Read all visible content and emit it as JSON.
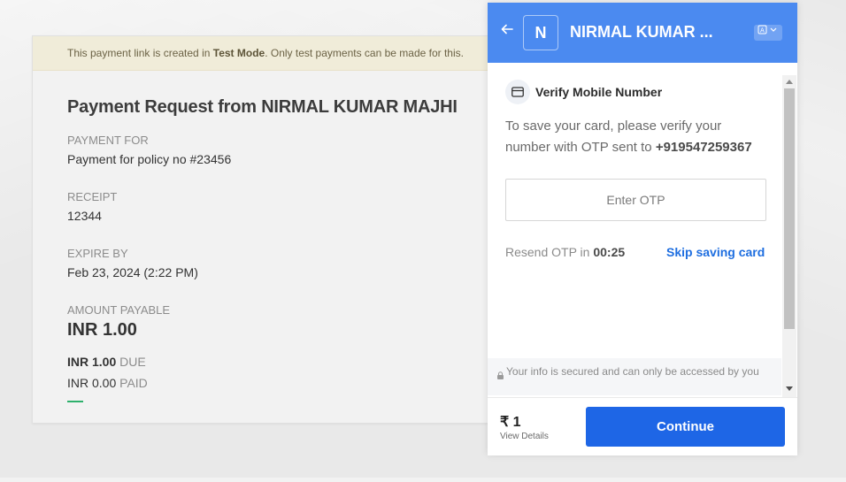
{
  "test_banner": {
    "prefix": "This payment link is created in ",
    "mode": "Test Mode",
    "suffix": ". Only test payments can be made for this."
  },
  "payment": {
    "title": "Payment Request from NIRMAL KUMAR MAJHI",
    "payment_for_label": "PAYMENT FOR",
    "payment_for_value": "Payment for policy no #23456",
    "receipt_label": "RECEIPT",
    "receipt_value": "12344",
    "expire_label": "EXPIRE BY",
    "expire_value": "Feb 23, 2024 (2:22 PM)",
    "amount_label": "AMOUNT PAYABLE",
    "amount_value": "INR 1.00",
    "due_amount": "INR 1.00",
    "due_label": "DUE",
    "paid_amount": "INR 0.00",
    "paid_label": "PAID"
  },
  "checkout": {
    "logo_letter": "N",
    "merchant_name": "NIRMAL KUMAR ...",
    "verify_title": "Verify Mobile Number",
    "verify_text": "To save your card, please verify your number with OTP sent to ",
    "phone": "+919547259367",
    "otp_placeholder": "Enter OTP",
    "resend_text": "Resend OTP in ",
    "resend_timer": "00:25",
    "skip_label": "Skip saving card",
    "secure_note": "Your info is secured and can only be accessed by you",
    "total_amount": "₹ 1",
    "view_details": "View Details",
    "continue_label": "Continue"
  },
  "colors": {
    "header_blue": "#4b8af0",
    "button_blue": "#1e66e6",
    "link_blue": "#1e6ee0",
    "paid_green": "#2eb06c",
    "test_banner_bg": "#f0ecd9"
  },
  "icons": {
    "back": "arrow-left-icon",
    "language": "translate-icon",
    "card": "credit-card-icon",
    "lock": "lock-icon"
  }
}
